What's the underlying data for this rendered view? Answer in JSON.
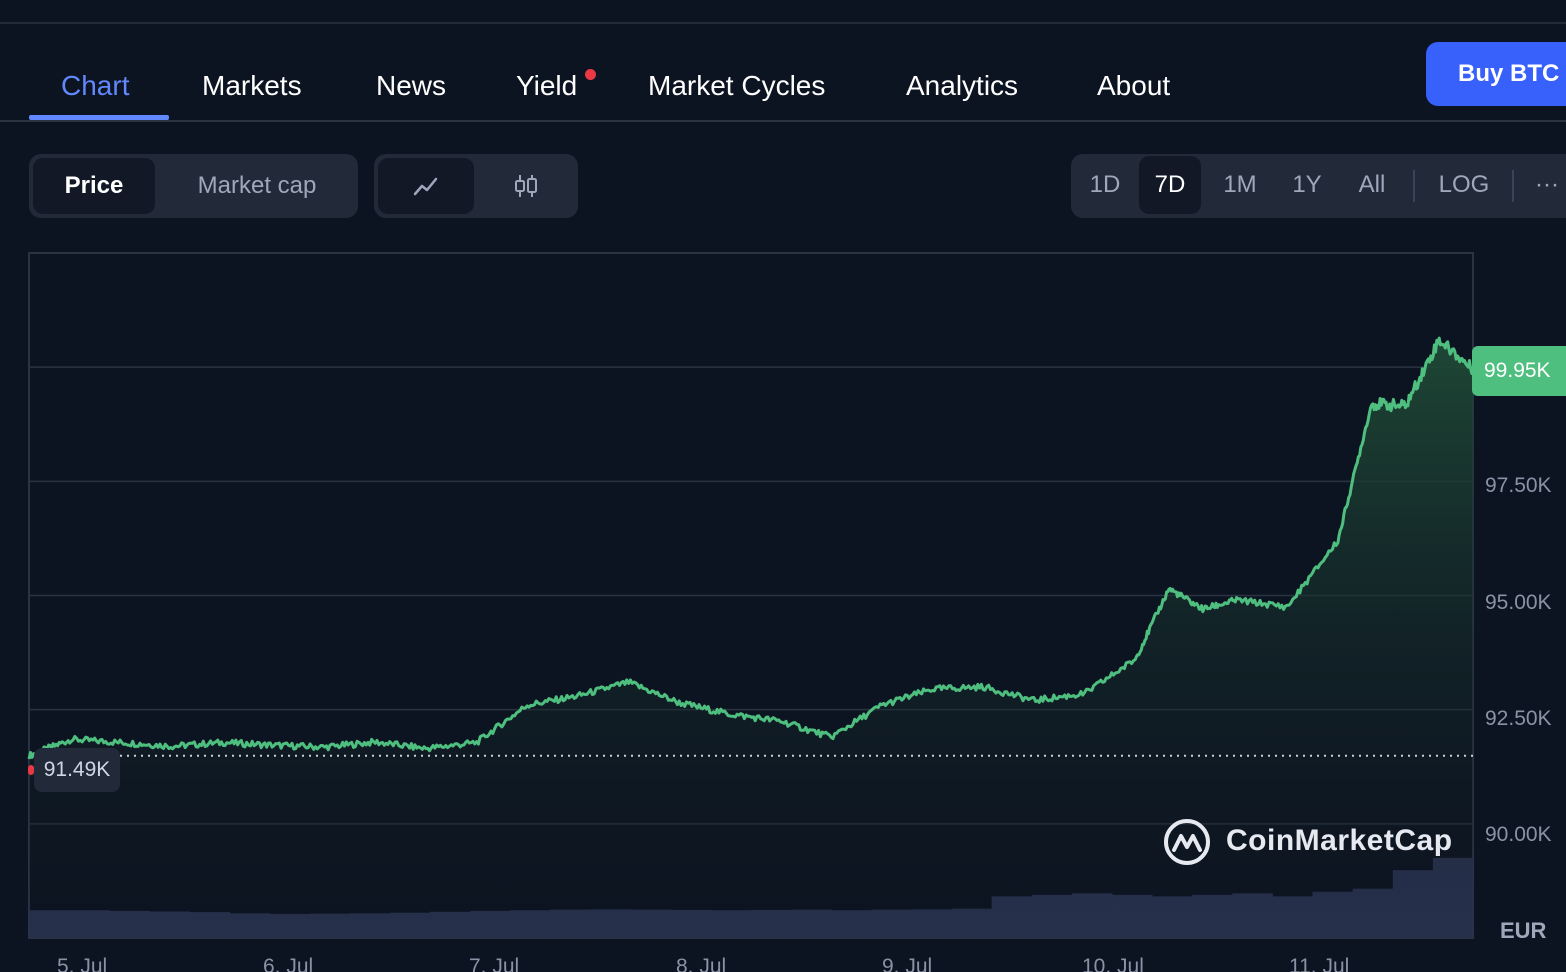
{
  "tabs": {
    "items": [
      {
        "label": "Chart",
        "active": true
      },
      {
        "label": "Markets"
      },
      {
        "label": "News"
      },
      {
        "label": "Yield",
        "badge": true
      },
      {
        "label": "Market Cycles"
      },
      {
        "label": "Analytics"
      },
      {
        "label": "About"
      }
    ],
    "buy_label": "Buy BTC"
  },
  "controls": {
    "metric": {
      "options": [
        "Price",
        "Market cap"
      ],
      "selected": "Price"
    },
    "chart_style": {
      "options": [
        "line-chart-icon",
        "candlestick-icon"
      ],
      "selected": "line-chart-icon"
    },
    "ranges": {
      "options": [
        "1D",
        "7D",
        "1M",
        "1Y",
        "All"
      ],
      "selected": "7D"
    },
    "log_label": "LOG",
    "more_label": "···"
  },
  "chart_data": {
    "type": "area",
    "currency": "EUR",
    "ylim": [
      87500,
      102500
    ],
    "y_ticks": [
      "90.00K",
      "92.50K",
      "95.00K",
      "97.50K"
    ],
    "x_ticks": [
      "5. Jul",
      "6. Jul",
      "7. Jul",
      "8. Jul",
      "9. Jul",
      "10. Jul",
      "11. Jul"
    ],
    "current_price_label": "99.95K",
    "start_price_label": "91.49K",
    "start_price": 91490,
    "series": [
      {
        "x": [
          "2025-07-04 13:00",
          "2025-07-04 18:00",
          "2025-07-05 00:00",
          "2025-07-05 06:00",
          "2025-07-05 12:00",
          "2025-07-05 18:00",
          "2025-07-06 00:00",
          "2025-07-06 06:00",
          "2025-07-06 12:00",
          "2025-07-06 18:00",
          "2025-07-07 00:00",
          "2025-07-07 06:00",
          "2025-07-07 12:00",
          "2025-07-07 18:00",
          "2025-07-08 00:00",
          "2025-07-08 06:00",
          "2025-07-08 12:00",
          "2025-07-08 18:00",
          "2025-07-09 00:00",
          "2025-07-09 06:00",
          "2025-07-09 12:00",
          "2025-07-09 18:00",
          "2025-07-10 00:00",
          "2025-07-10 04:00",
          "2025-07-10 08:00",
          "2025-07-10 12:00",
          "2025-07-10 18:00",
          "2025-07-11 00:00",
          "2025-07-11 04:00",
          "2025-07-11 08:00",
          "2025-07-11 12:00",
          "2025-07-11 16:00"
        ],
        "values": [
          91490,
          91850,
          91780,
          91700,
          91780,
          91720,
          91680,
          91790,
          91650,
          91780,
          92600,
          92800,
          93100,
          92650,
          92400,
          92250,
          91900,
          92600,
          92950,
          93000,
          92700,
          92850,
          93600,
          95150,
          94700,
          94900,
          94750,
          96200,
          99200,
          99150,
          100600,
          99950
        ]
      }
    ],
    "volume": [
      0.09,
      0.09,
      0.088,
      0.086,
      0.084,
      0.08,
      0.078,
      0.079,
      0.08,
      0.082,
      0.085,
      0.088,
      0.09,
      0.092,
      0.093,
      0.092,
      0.091,
      0.09,
      0.091,
      0.092,
      0.09,
      0.092,
      0.093,
      0.095,
      0.135,
      0.14,
      0.145,
      0.14,
      0.135,
      0.14,
      0.145,
      0.135,
      0.15,
      0.16,
      0.22,
      0.26
    ],
    "grid": true,
    "colors": {
      "line": "#4ebf7e",
      "area_top": "#1f4a36",
      "volume": "#2b3553",
      "grid": "#2a3342",
      "background": "#0d1421"
    }
  },
  "watermark": {
    "label": "CoinMarketCap"
  }
}
